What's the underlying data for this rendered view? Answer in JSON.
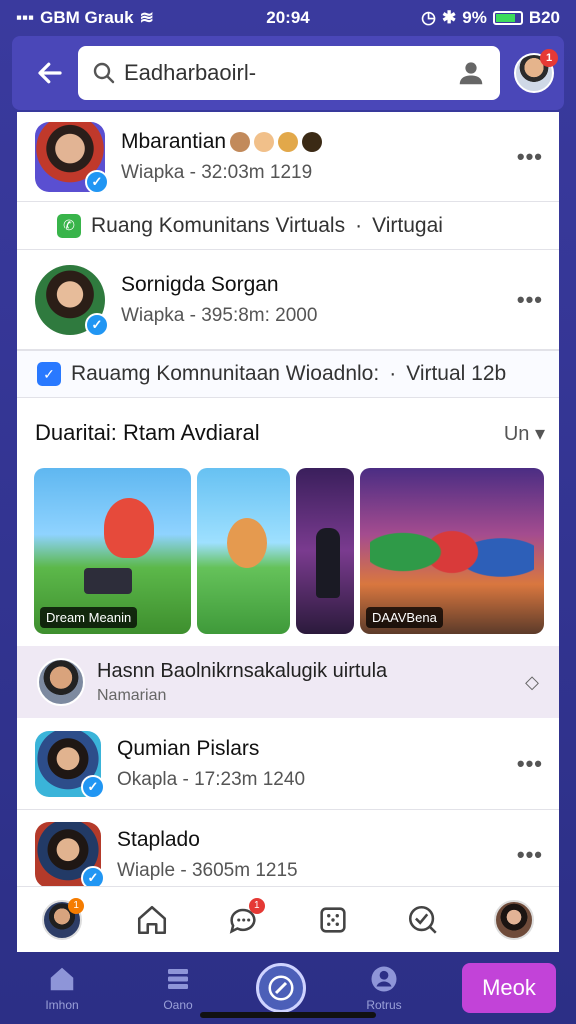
{
  "status_bar": {
    "carrier": "GBM Grauk",
    "time": "20:94",
    "battery": "9%",
    "right_text": "B20"
  },
  "search": {
    "value": "Eadharbaoirl-",
    "profile_badge": "1"
  },
  "posts_top": [
    {
      "name": "Mbarantian",
      "meta": "Wiapka - 32:03m 1219"
    },
    {
      "name": "Sornigda Sorgan",
      "meta": "Wiapka - 395:8m: 2000"
    }
  ],
  "community_1": {
    "text": "Ruang Komunitans Virtuals",
    "suffix": "Virtugai"
  },
  "community_2": {
    "text": "Rauamg Komnunitaan Wioadnlo:",
    "suffix": "Virtual 12b"
  },
  "section": {
    "title": "Duaritai: Rtam Avdiaral",
    "action": "Un"
  },
  "thumbnails": [
    {
      "label": "Dream Meanin"
    },
    {
      "label": ""
    },
    {
      "label": ""
    },
    {
      "label": "DAAVBena"
    }
  ],
  "suggestion": {
    "title": "Hasnn Baolnikrnsakalugik uirtula",
    "subtitle": "Namarian"
  },
  "posts_bottom": [
    {
      "name": "Qumian Pislars",
      "meta": "Okapla - 17:23m 1240"
    },
    {
      "name": "Staplado",
      "meta": "Wiaple - 3605m 1215"
    }
  ],
  "card_tabs": {
    "profile_badge": "1",
    "chat_badge": "1"
  },
  "bottom_nav": {
    "home_label": "Imhon",
    "list_label": "Oano",
    "profile_label": "Rotrus",
    "cta_label": "Meok"
  },
  "colors": {
    "background": "#3a3a9e",
    "header": "#4a47b8",
    "cta": "#c243d8",
    "verified": "#2196f3",
    "suggestion_bg": "#efe9f4"
  }
}
